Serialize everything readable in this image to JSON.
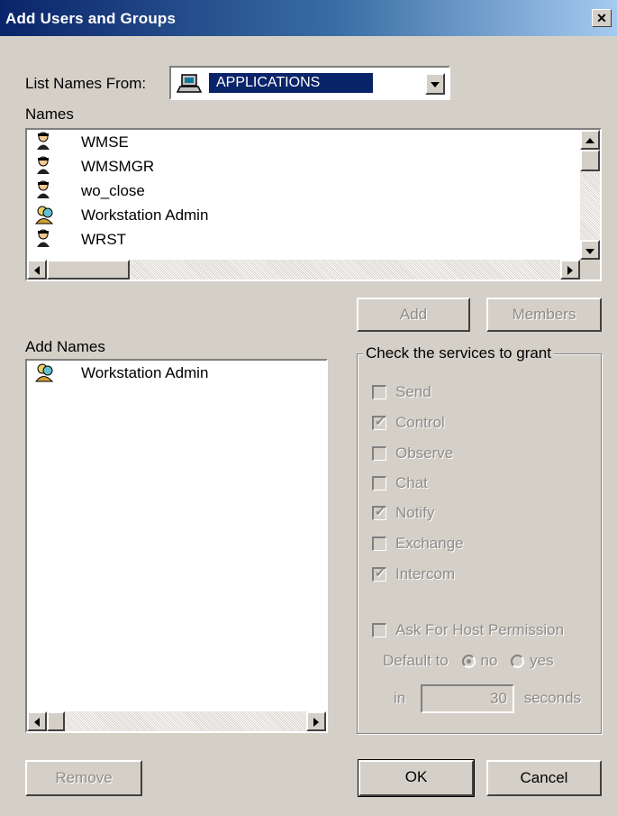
{
  "window": {
    "title": "Add Users and Groups",
    "close_glyph": "✕"
  },
  "list_names_from": {
    "label": "List Names From:",
    "selected": "APPLICATIONS",
    "icon": "computer-icon"
  },
  "names": {
    "label": "Names",
    "items": [
      {
        "label": "WMSE",
        "icon": "user-icon"
      },
      {
        "label": "WMSMGR",
        "icon": "user-icon"
      },
      {
        "label": "wo_close",
        "icon": "user-icon"
      },
      {
        "label": "Workstation Admin",
        "icon": "group-icon"
      },
      {
        "label": "WRST",
        "icon": "user-icon"
      }
    ]
  },
  "buttons": {
    "add": "Add",
    "members": "Members",
    "remove": "Remove",
    "ok": "OK",
    "cancel": "Cancel"
  },
  "add_names": {
    "label": "Add Names",
    "items": [
      {
        "label": "Workstation Admin",
        "icon": "group-icon"
      }
    ]
  },
  "services": {
    "legend": "Check the services to grant",
    "items": [
      {
        "label": "Send",
        "checked": false
      },
      {
        "label": "Control",
        "checked": true
      },
      {
        "label": "Observe",
        "checked": false
      },
      {
        "label": "Chat",
        "checked": false
      },
      {
        "label": "Notify",
        "checked": true
      },
      {
        "label": "Exchange",
        "checked": false
      },
      {
        "label": "Intercom",
        "checked": true
      }
    ],
    "ask_permission": "Ask For Host Permission",
    "default_to": "Default to",
    "no": "no",
    "yes": "yes",
    "in": "in",
    "seconds_value": "30",
    "seconds": "seconds"
  }
}
